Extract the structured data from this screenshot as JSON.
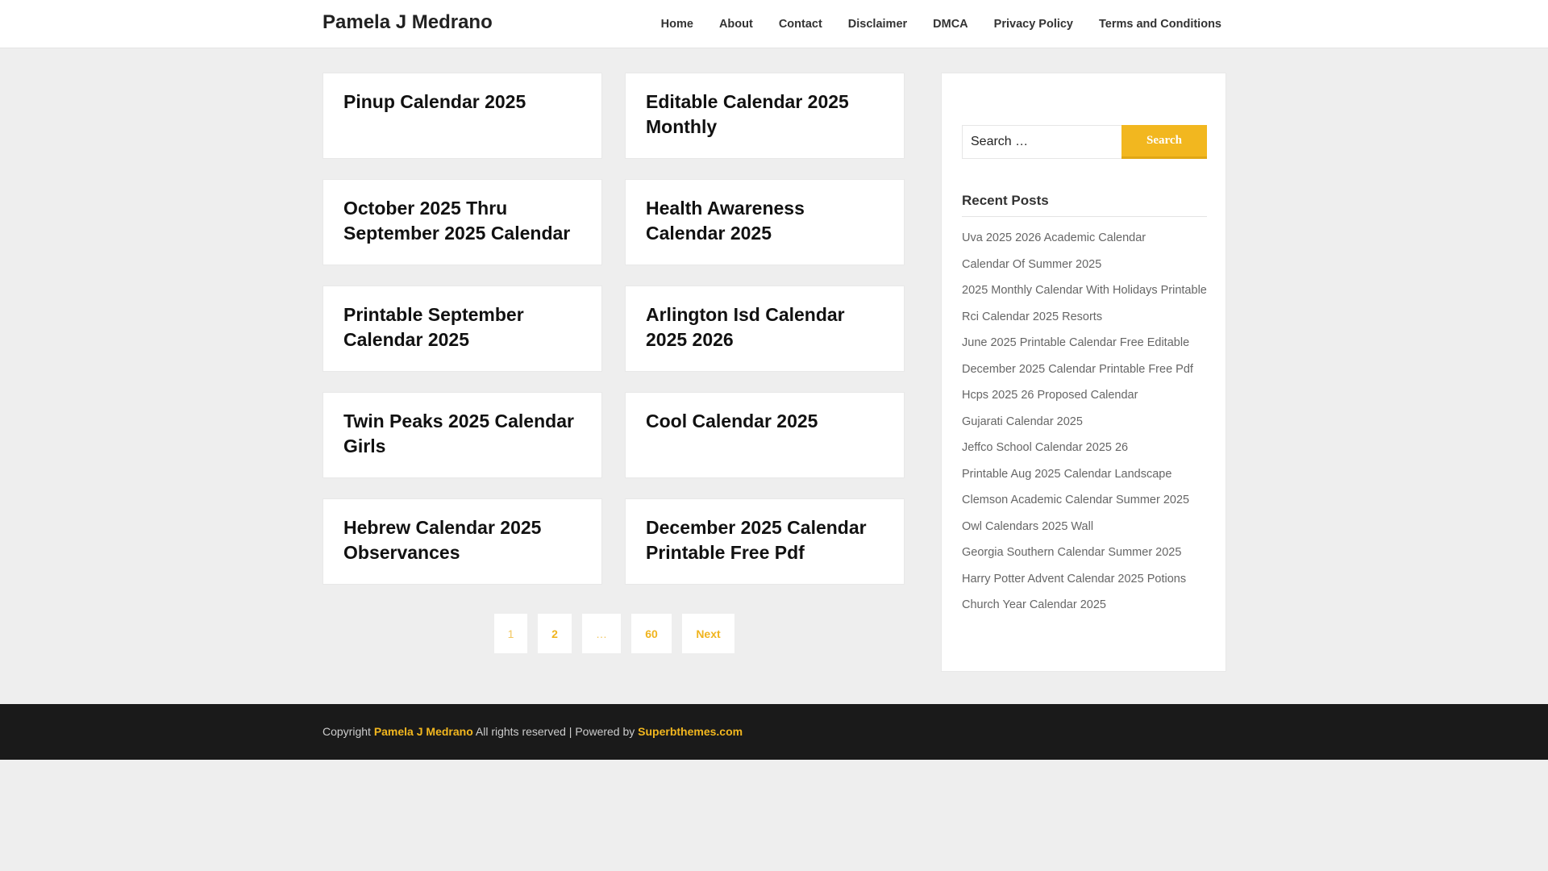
{
  "header": {
    "site_title": "Pamela J Medrano",
    "nav": [
      "Home",
      "About",
      "Contact",
      "Disclaimer",
      "DMCA",
      "Privacy Policy",
      "Terms and Conditions"
    ]
  },
  "posts": [
    {
      "title": "Pinup Calendar 2025"
    },
    {
      "title": "Editable Calendar 2025 Monthly"
    },
    {
      "title": "October 2025 Thru September 2025 Calendar"
    },
    {
      "title": "Health Awareness Calendar 2025"
    },
    {
      "title": "Printable September Calendar 2025"
    },
    {
      "title": "Arlington Isd Calendar 2025 2026"
    },
    {
      "title": "Twin Peaks 2025 Calendar Girls"
    },
    {
      "title": "Cool Calendar 2025"
    },
    {
      "title": "Hebrew Calendar 2025 Observances"
    },
    {
      "title": "December 2025 Calendar Printable Free Pdf"
    }
  ],
  "pagination": {
    "current": "1",
    "page2": "2",
    "dots": "…",
    "last": "60",
    "next": "Next"
  },
  "sidebar": {
    "search": {
      "placeholder": "Search …",
      "button": "Search"
    },
    "recent_posts_title": "Recent Posts",
    "recent_posts": [
      "Uva 2025 2026 Academic Calendar",
      "Calendar Of Summer 2025",
      "2025 Monthly Calendar With Holidays Printable",
      "Rci Calendar 2025 Resorts",
      "June 2025 Printable Calendar Free Editable",
      "December 2025 Calendar Printable Free Pdf",
      "Hcps 2025 26 Proposed Calendar",
      "Gujarati Calendar 2025",
      "Jeffco School Calendar 2025 26",
      "Printable Aug 2025 Calendar Landscape",
      "Clemson Academic Calendar Summer 2025",
      "Owl Calendars 2025 Wall",
      "Georgia Southern Calendar Summer 2025",
      "Harry Potter Advent Calendar 2025 Potions",
      "Church Year Calendar 2025"
    ]
  },
  "footer": {
    "copyright_label": "Copyright",
    "site_link": "Pamela J Medrano",
    "rights_text": "All rights reserved | Powered by",
    "theme_link": "Superbthemes.com"
  },
  "colors": {
    "accent": "#f2b71f",
    "background": "#eeeeee",
    "footer": "#1a1a1a"
  }
}
